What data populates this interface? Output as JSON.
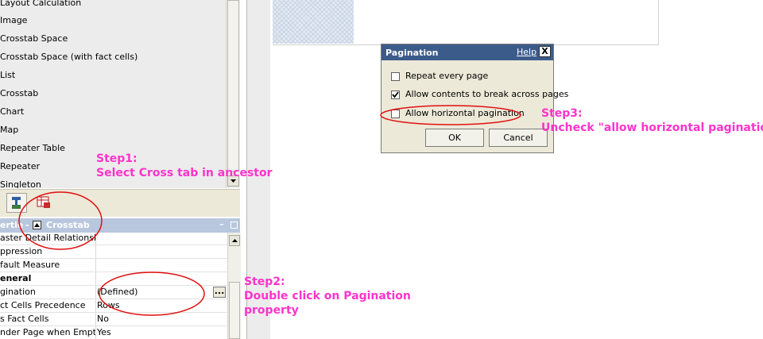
{
  "toolbox": {
    "items": [
      "Layout Calculation",
      "Image",
      "Crosstab Space",
      "Crosstab Space (with fact cells)",
      "List",
      "Crosstab",
      "Chart",
      "Map",
      "Repeater Table",
      "Repeater",
      "Singleton"
    ]
  },
  "properties": {
    "header_prefix": "ertie",
    "header_title": "Crosstab",
    "rows": [
      {
        "name": "aster Detail Relationships",
        "value": ""
      },
      {
        "name": "ppression",
        "value": ""
      },
      {
        "name": "fault Measure",
        "value": ""
      },
      {
        "name": "eneral",
        "value": ""
      },
      {
        "name": "gination",
        "value": "(Defined)"
      },
      {
        "name": "ct Cells Precedence",
        "value": "Rows"
      },
      {
        "name": "s Fact Cells",
        "value": "No"
      },
      {
        "name": "nder Page when Empty",
        "value": "Yes"
      }
    ],
    "ellipsis": "..."
  },
  "dialog": {
    "title": "Pagination",
    "help": "Help",
    "close": "X",
    "options": [
      {
        "label": "Repeat every page",
        "checked": false
      },
      {
        "label": "Allow contents to break across pages",
        "checked": true
      },
      {
        "label": "Allow horizontal pagination",
        "checked": false
      }
    ],
    "ok": "OK",
    "cancel": "Cancel"
  },
  "annotations": {
    "step1_line1": "Step1:",
    "step1_line2": "Select Cross tab in ancestor",
    "step2_line1": "Step2:",
    "step2_line2": "Double click on Pagination",
    "step2_line3": "property",
    "step3_line1": "Step3:",
    "step3_line2": "Uncheck \"allow horizontal pagination\""
  },
  "colors": {
    "annotation": "#ff33cc",
    "ellipse": "#e01010",
    "dialog_title": "#3b5b8a",
    "properties_header": "#b8c7dd"
  }
}
